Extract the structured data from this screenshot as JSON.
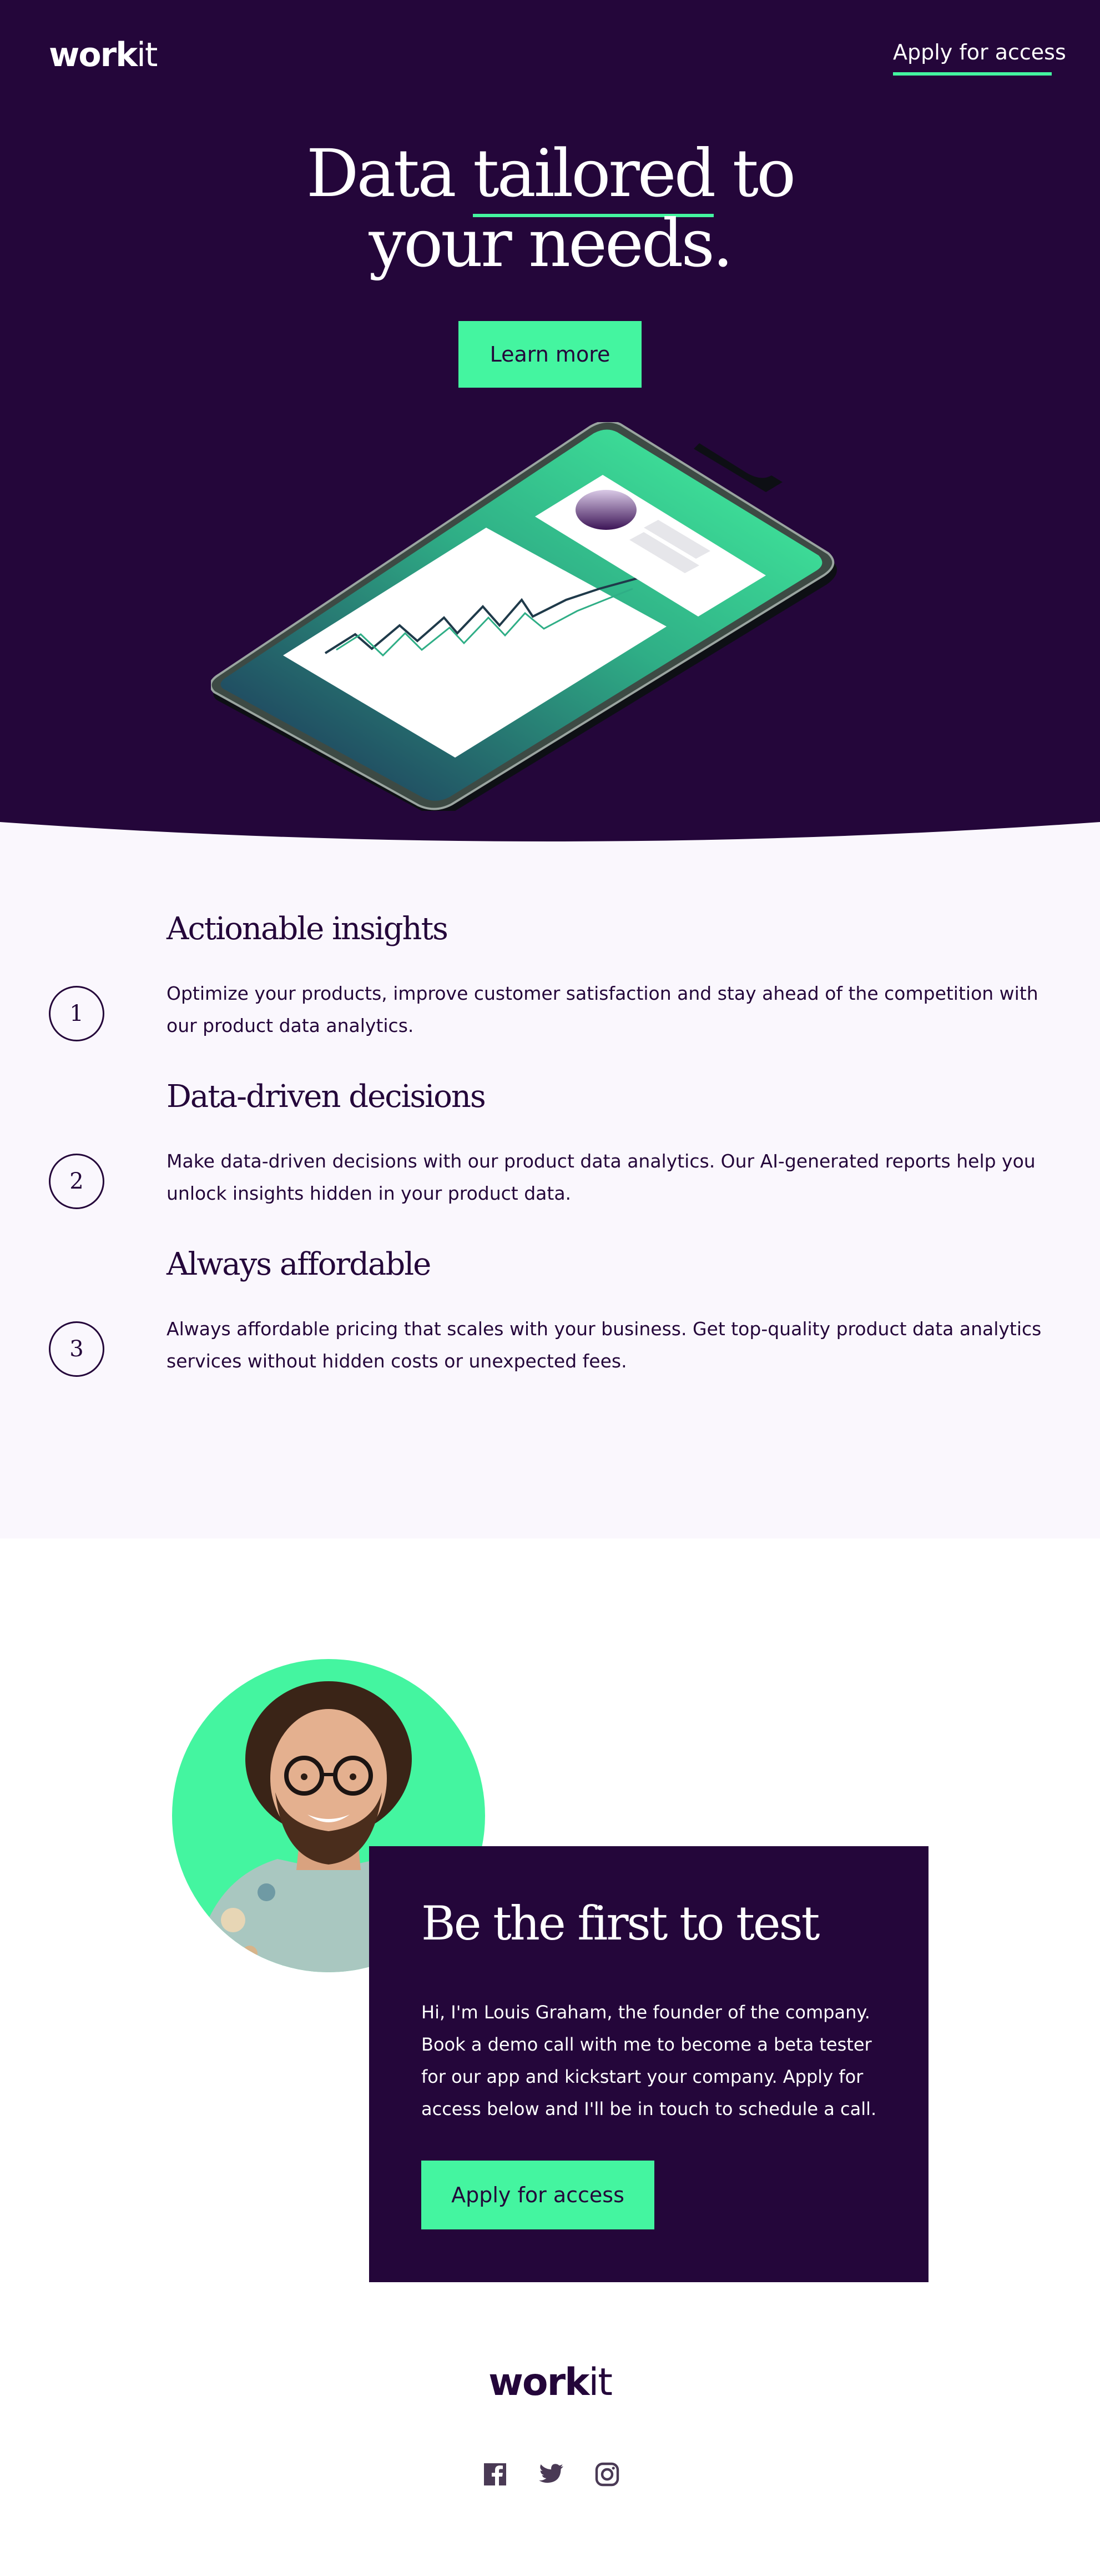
{
  "header": {
    "logo_bold": "work",
    "logo_light": "it",
    "nav_cta": "Apply for access"
  },
  "hero": {
    "title_part1": "Data ",
    "title_highlight": "tailored",
    "title_part2": " to",
    "title_line2": "your needs.",
    "button_label": "Learn more"
  },
  "features": [
    {
      "number": "1",
      "title": "Actionable insights",
      "description": "Optimize your products, improve customer satisfaction and stay ahead of the competition with our product data analytics."
    },
    {
      "number": "2",
      "title": "Data-driven decisions",
      "description": "Make data-driven decisions with our product data analytics. Our AI-generated reports help you unlock insights hidden in your product data."
    },
    {
      "number": "3",
      "title": "Always affordable",
      "description": "Always affordable pricing that scales with your business. Get top-quality product data analytics services without hidden costs or unexpected fees."
    }
  ],
  "cta": {
    "title": "Be the first to test",
    "text": "Hi, I'm Louis Graham, the founder of the company. Book a demo call with me to become a beta tester for our app and kickstart your company. Apply for access below and I'll be in touch to schedule a call.",
    "button_label": "Apply for access"
  },
  "footer": {
    "logo_bold": "work",
    "logo_light": "it",
    "socials": [
      "facebook-icon",
      "twitter-icon",
      "instagram-icon"
    ]
  },
  "colors": {
    "brand_dark": "#24063a",
    "accent_green": "#44f5a0",
    "light_bg": "#faf7fd"
  }
}
